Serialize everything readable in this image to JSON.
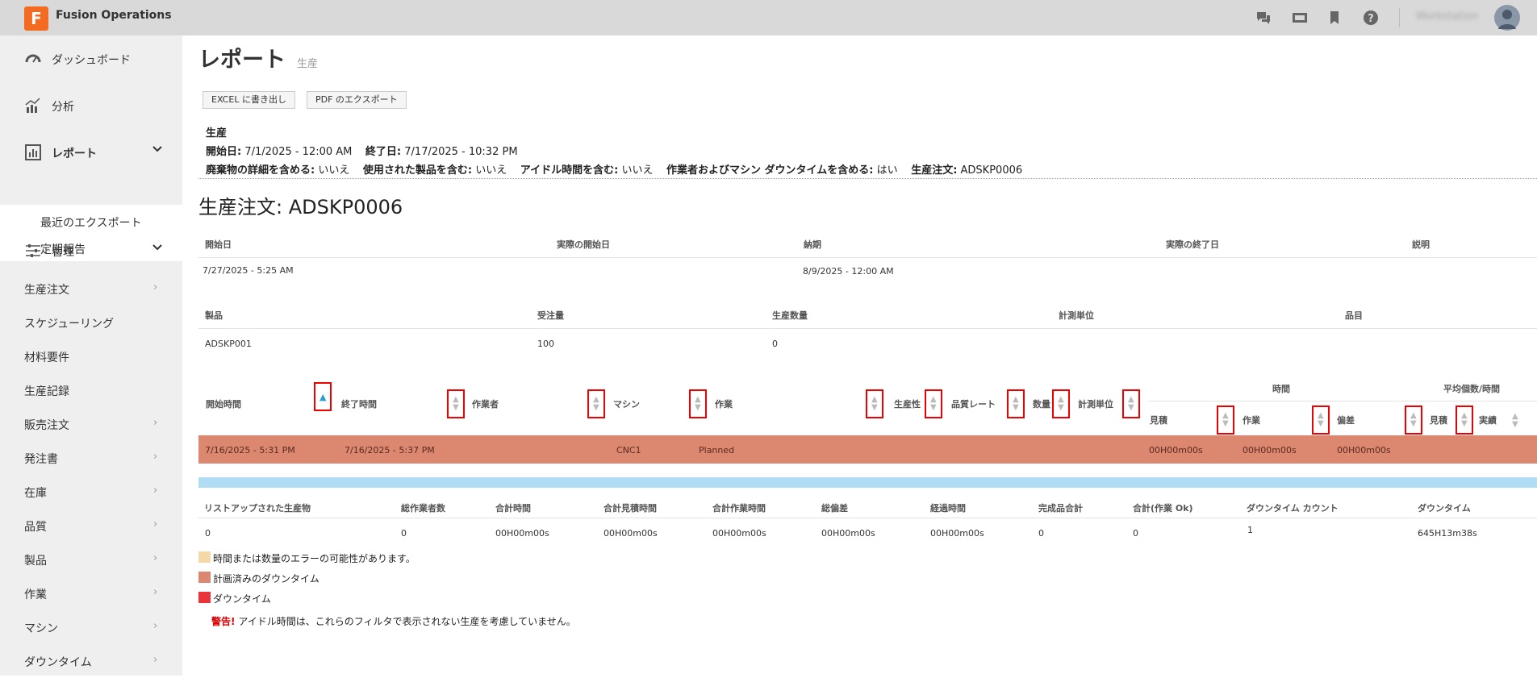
{
  "app": {
    "name": "Fusion Operations",
    "logo_letter": "F",
    "username": "Workstation"
  },
  "topbar": {
    "icons": [
      "chat-icon",
      "display-icon",
      "bookmark-icon",
      "help-icon"
    ]
  },
  "sidebar": {
    "main_items": [
      {
        "label": "ダッシュボード",
        "icon": "dashboard-icon"
      },
      {
        "label": "分析",
        "icon": "analytics-icon"
      },
      {
        "label": "レポート",
        "icon": "report-icon",
        "expanded": true
      },
      {
        "label": "管理",
        "icon": "settings-sliders-icon",
        "expanded": true
      }
    ],
    "report_sub": [
      "最近のエクスポート",
      "定期報告"
    ],
    "admin_items": [
      {
        "label": "生産注文",
        "chevron": true
      },
      {
        "label": "スケジューリング",
        "chevron": false
      },
      {
        "label": "材料要件",
        "chevron": false
      },
      {
        "label": "生産記録",
        "chevron": false
      },
      {
        "label": "販売注文",
        "chevron": true
      },
      {
        "label": "発注書",
        "chevron": true
      },
      {
        "label": "在庫",
        "chevron": true
      },
      {
        "label": "品質",
        "chevron": true
      },
      {
        "label": "製品",
        "chevron": true
      },
      {
        "label": "作業",
        "chevron": true
      },
      {
        "label": "マシン",
        "chevron": true
      },
      {
        "label": "ダウンタイム",
        "chevron": true
      }
    ]
  },
  "page": {
    "title": "レポート",
    "subtitle": "生産",
    "export_excel": "EXCEL に書き出し",
    "export_pdf": "PDF のエクスポート"
  },
  "filters": {
    "heading": "生産",
    "start_label": "開始日:",
    "start_value": "7/1/2025 - 12:00 AM",
    "end_label": "終了日:",
    "end_value": "7/17/2025 - 10:32 PM",
    "waste_label": "廃棄物の詳細を含める:",
    "waste_value": "いいえ",
    "used_label": "使用された製品を含む:",
    "used_value": "いいえ",
    "idle_label": "アイドル時間を含む:",
    "idle_value": "いいえ",
    "downtime_label": "作業者およびマシン ダウンタイムを含める:",
    "downtime_value": "はい",
    "order_label": "生産注文:",
    "order_value": "ADSKP0006"
  },
  "order": {
    "title_label": "生産注文:",
    "title_value": "ADSKP0006",
    "table1_headers": [
      "開始日",
      "実際の開始日",
      "納期",
      "実際の終了日",
      "説明"
    ],
    "table1_values": [
      "7/27/2025 - 5:25 AM",
      "",
      "8/9/2025 - 12:00 AM",
      "",
      ""
    ],
    "table2_headers": [
      "製品",
      "受注量",
      "生産数量",
      "計測単位",
      "品目"
    ],
    "table2_values": [
      "ADSKP001",
      "100",
      "0",
      "",
      ""
    ]
  },
  "production_table": {
    "group_time": "時間",
    "group_avg": "平均個数/時間",
    "headers": [
      "開始時間",
      "終了時間",
      "作業者",
      "マシン",
      "作業",
      "生産性",
      "品質レート",
      "数量",
      "計測単位",
      "見積",
      "作業",
      "偏差",
      "見積",
      "実績"
    ],
    "row": {
      "start": "7/16/2025 - 5:31 PM",
      "end": "7/16/2025 - 5:37 PM",
      "machine": "CNC1",
      "operation": "Planned",
      "est": "00H00m00s",
      "work": "00H00m00s",
      "dev": "00H00m00s"
    },
    "row_color": "#dc8870"
  },
  "summary": {
    "headers": [
      "リストアップされた生産物",
      "総作業者数",
      "合計時間",
      "合計見積時間",
      "合計作業時間",
      "総偏差",
      "経過時間",
      "完成品合計",
      "合計(作業 Ok)",
      "ダウンタイム カウント",
      "ダウンタイム"
    ],
    "values": [
      "0",
      "0",
      "00H00m00s",
      "00H00m00s",
      "00H00m00s",
      "00H00m00s",
      "00H00m00s",
      "0",
      "0",
      "1",
      "645H13m38s"
    ]
  },
  "legend": [
    {
      "label": "時間または数量のエラーの可能性があります。",
      "color": "#f3d9a8"
    },
    {
      "label": "計画済みのダウンタイム",
      "color": "#dc8870"
    },
    {
      "label": "ダウンタイム",
      "color": "#e8353a"
    }
  ],
  "warning": {
    "prefix": "警告!",
    "text": "アイドル時間は、これらのフィルタで表示されない生産を考慮していません。"
  }
}
